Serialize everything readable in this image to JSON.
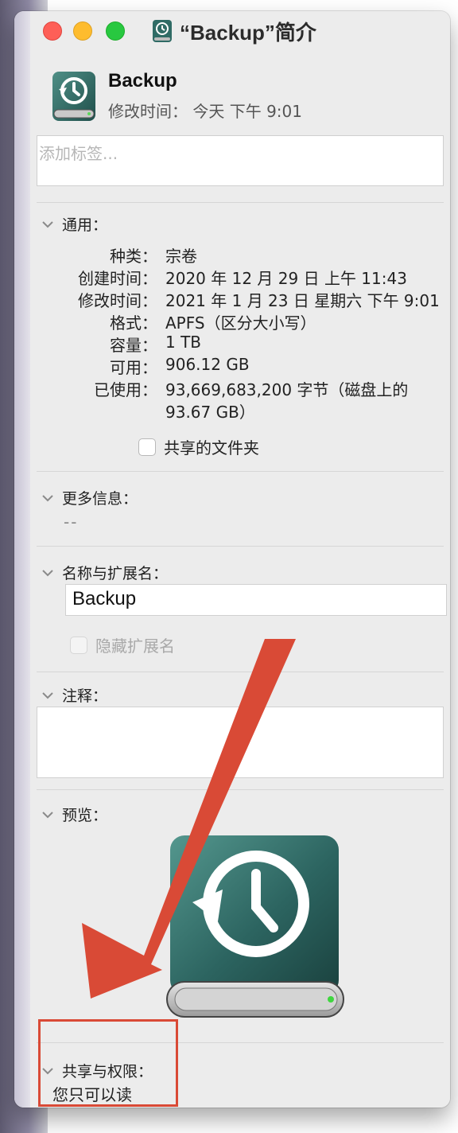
{
  "window": {
    "title": "“Backup”简介"
  },
  "header": {
    "volume_name": "Backup",
    "modified": "修改时间： 今天 下午 9:01",
    "icon": "time-machine-drive-icon"
  },
  "tags": {
    "placeholder": "添加标签..."
  },
  "general": {
    "title": "通用：",
    "rows": [
      {
        "label": "种类：",
        "value": "宗卷"
      },
      {
        "label": "创建时间：",
        "value": "2020 年 12 月 29 日 上午 11:43"
      },
      {
        "label": "修改时间：",
        "value": "2021 年 1 月 23 日 星期六 下午 9:01"
      },
      {
        "label": "格式：",
        "value": "APFS（区分大小写）"
      },
      {
        "label": "容量：",
        "value": "1 TB"
      },
      {
        "label": "可用：",
        "value": "906.12 GB"
      },
      {
        "label": "已使用：",
        "value": "93,669,683,200 字节（磁盘上的"
      },
      {
        "label": "",
        "value": "93.67 GB）"
      }
    ],
    "shared_folder_label": "共享的文件夹"
  },
  "more_info": {
    "title": "更多信息：",
    "value": "--"
  },
  "name_ext": {
    "title": "名称与扩展名：",
    "name_value": "Backup",
    "hide_ext_label": "隐藏扩展名"
  },
  "comments": {
    "title": "注释："
  },
  "preview": {
    "title": "预览："
  },
  "permissions": {
    "title": "共享与权限：",
    "value": "您只可以读"
  },
  "colors": {
    "drive_body": "#2f6b65",
    "annotation": "#d94a36",
    "close": "#fe5f57",
    "minimize": "#febc2e",
    "maximize": "#28c840"
  }
}
